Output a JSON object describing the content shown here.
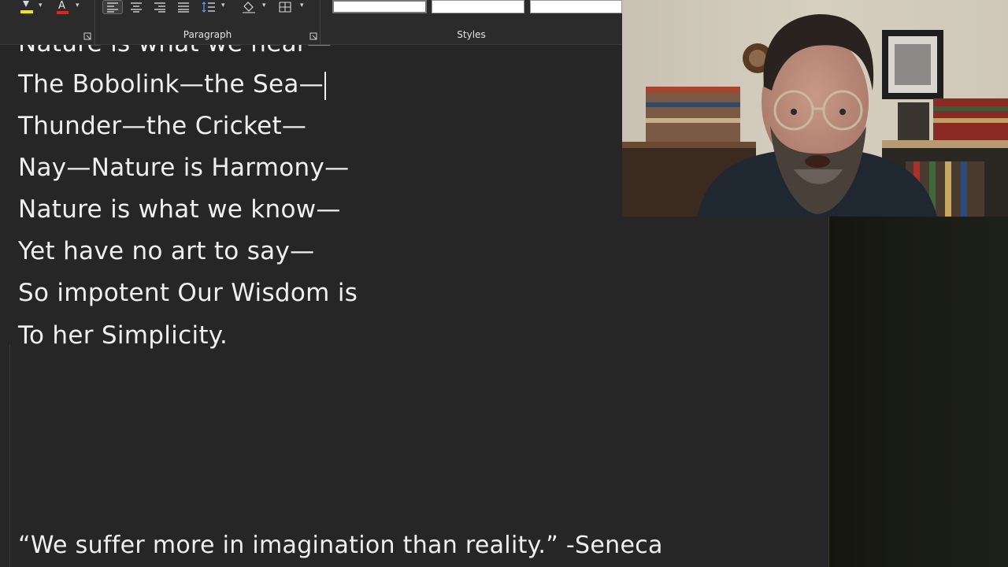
{
  "ribbon": {
    "groups": {
      "paragraph_label": "Paragraph",
      "styles_label": "Styles"
    },
    "icons": {
      "highlight_color": "#f2e600",
      "font_color": "#e0261f",
      "font_color_glyph": "A"
    }
  },
  "document": {
    "lines": [
      "Nature is what we hear—",
      "The Bobolink—the Sea—",
      "Thunder—the Cricket—",
      "Nay—Nature is Harmony—",
      "Nature is what we know—",
      "Yet have no art to say—",
      "So impotent Our Wisdom is",
      "To her Simplicity."
    ],
    "quote": "“We suffer more in imagination than reality.” -Seneca"
  },
  "webcam": {
    "description_icon": "video-feed"
  }
}
